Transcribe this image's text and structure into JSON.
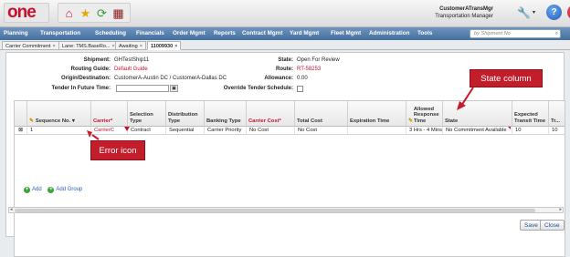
{
  "app": {
    "logo_text": "one",
    "user_name": "CustomerATransMgr",
    "user_role": "Transportation Manager"
  },
  "nav": {
    "items": [
      "Planning",
      "Transportation",
      "Scheduling",
      "Financials",
      "Order Mgmt",
      "Reports",
      "Contract Mgmt",
      "Yard Mgmt",
      "Fleet Mgmt",
      "Administration",
      "Tools"
    ],
    "search_placeholder": "by Shipment No"
  },
  "tabs": [
    {
      "label": "Carrier Commitment"
    },
    {
      "label": "Lane: TMS.BaseRo..."
    },
    {
      "label": "Awaiting"
    },
    {
      "label": "11009930"
    }
  ],
  "shipment": {
    "shipment_label": "Shipment:",
    "shipment_value": "GHTestShip11",
    "routing_label": "Routing Guide:",
    "routing_value": "Default Guide",
    "origin_label": "Origin/Destination:",
    "origin_value": "CustomerA-Austin DC / CustomerA-Dallas DC",
    "tender_label": "Tender In Future Time:",
    "state_label": "State:",
    "state_value": "Open For Review",
    "route_label": "Route:",
    "route_value": "RT-58253",
    "allowance_label": "Allowance:",
    "allowance_value": "0.00",
    "override_label": "Override Tender Schedule:"
  },
  "grid": {
    "columns": [
      "Sequence No.",
      "Carrier*",
      "Selection Type",
      "Distribution Type",
      "Banking Type",
      "Carrier Cost*",
      "Total Cost",
      "Expiration Time",
      "Allowed Response Time",
      "State",
      "Expected Transit Time",
      "Tr..."
    ],
    "rows": [
      {
        "seq": "1",
        "carrier": "CarrierC",
        "selection": "Contract",
        "distribution": "Sequential",
        "banking": "Carrier Priority",
        "carrier_cost": "No Cost",
        "total_cost": "No Cost",
        "expiration": "",
        "allowed": "3 Hrs - 4 Mins",
        "state": "No Commitment Available",
        "transit": "10",
        "tr": "10"
      }
    ],
    "add_label": "Add",
    "add_group_label": "Add Group"
  },
  "callouts": {
    "state_column": "State column",
    "error_icon": "Error icon"
  },
  "buttons": {
    "save": "Save",
    "close": "Close"
  }
}
